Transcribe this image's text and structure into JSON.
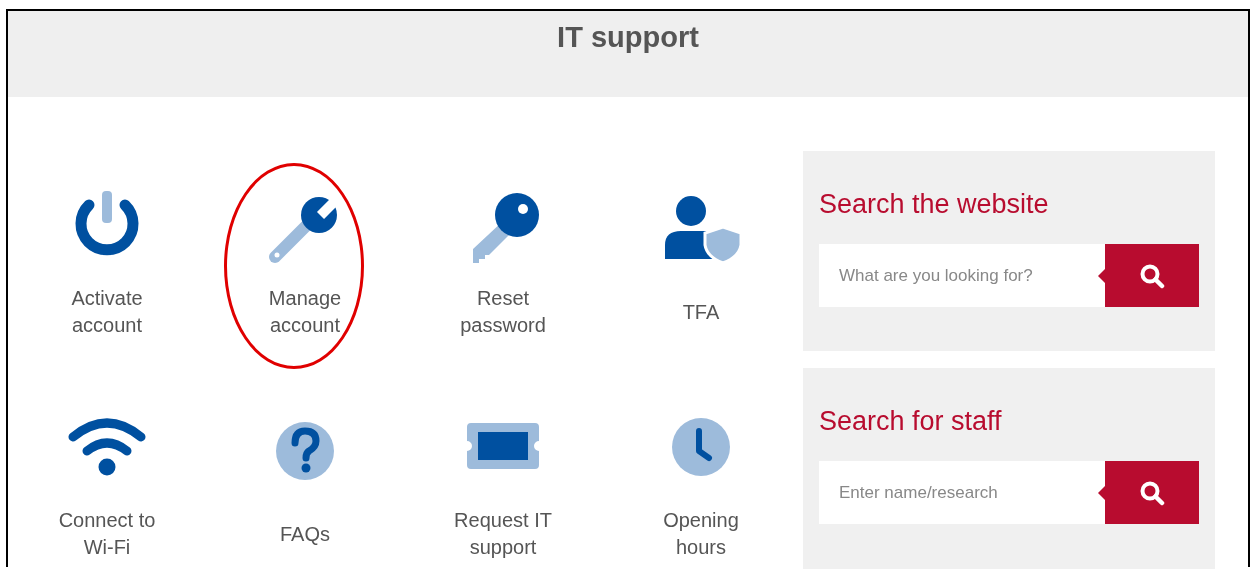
{
  "header": {
    "title": "IT support"
  },
  "tiles": [
    {
      "label": "Activate account",
      "circled": false
    },
    {
      "label": "Manage account",
      "circled": true
    },
    {
      "label": "Reset password",
      "circled": false
    },
    {
      "label": "TFA",
      "circled": false
    },
    {
      "label": "Connect to Wi-Fi",
      "circled": false
    },
    {
      "label": "FAQs",
      "circled": false
    },
    {
      "label": "Request IT support",
      "circled": false
    },
    {
      "label": "Opening hours",
      "circled": false
    }
  ],
  "search_panels": [
    {
      "title": "Search the website",
      "placeholder": "What are you looking for?"
    },
    {
      "title": "Search for staff",
      "placeholder": "Enter name/research"
    }
  ]
}
